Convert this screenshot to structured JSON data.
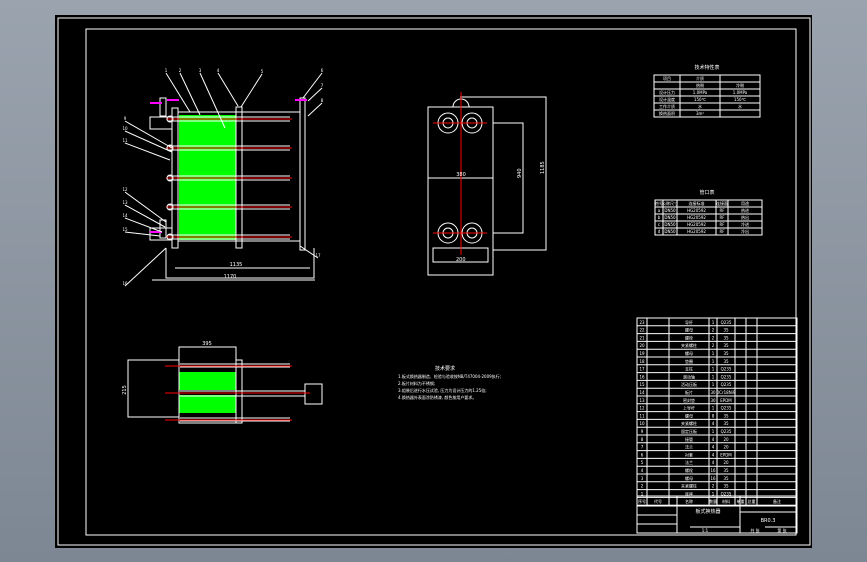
{
  "drawing": {
    "title_block": {
      "drawing_name": "板式换热器",
      "drawing_no": "BR0.3",
      "scale": "1:1",
      "sheet": "共 张",
      "sheet_of": "第 张"
    },
    "left_view": {
      "dim_inner": "1135",
      "dim_outer": "1170",
      "balloons": [
        "1",
        "2",
        "3",
        "4",
        "5",
        "6",
        "7",
        "8",
        "9",
        "10",
        "11",
        "12",
        "13",
        "14",
        "15",
        "16",
        "17"
      ]
    },
    "front_view": {
      "dim_width": "380",
      "dim_port": "200",
      "dim_height": "940",
      "dim_total_height": "1185"
    },
    "bottom_view": {
      "dim_width": "395",
      "dim_height": "215"
    },
    "notes": {
      "title": "技术要求",
      "items": [
        "1.板式换热器制造、检验与验收按NB/T47004-2009执行;",
        "2.板片材料为不锈钢;",
        "3.组装后进行水压试验, 压力为设计压力的1.25倍;",
        "4.换热器外表面涂防锈漆, 颜色按用户要求。"
      ]
    },
    "tech_table": {
      "title": "技术特性表",
      "header": [
        "项目",
        "介质",
        "热侧",
        "冷侧"
      ],
      "rows": [
        [
          "设计压力",
          "1.0MPa",
          "1.0MPa"
        ],
        [
          "设计温度",
          "150℃",
          "150℃"
        ],
        [
          "工作介质",
          "水",
          "水"
        ],
        [
          "换热面积",
          "3m²"
        ]
      ]
    },
    "nozzle_table": {
      "title": "管口表",
      "header": [
        "符号",
        "公称尺寸",
        "连接标准",
        "连接面",
        "用途"
      ],
      "rows": [
        [
          "a",
          "DN50",
          "HG20592",
          "RF",
          "热进"
        ],
        [
          "b",
          "DN50",
          "HG20592",
          "RF",
          "热出"
        ],
        [
          "c",
          "DN50",
          "HG20592",
          "RF",
          "冷进"
        ],
        [
          "d",
          "DN50",
          "HG20592",
          "RF",
          "冷出"
        ]
      ]
    },
    "parts_list": {
      "header": [
        "序号",
        "代号",
        "名称",
        "数量",
        "材料",
        "单重",
        "总重",
        "备注"
      ],
      "rows": [
        [
          "23",
          "",
          "导杆",
          "1",
          "Q235",
          "",
          ""
        ],
        [
          "22",
          "",
          "螺母",
          "2",
          "35",
          "",
          ""
        ],
        [
          "21",
          "",
          "螺栓",
          "2",
          "35",
          "",
          ""
        ],
        [
          "20",
          "",
          "夹紧螺柱",
          "2",
          "35",
          "",
          ""
        ],
        [
          "19",
          "",
          "螺母",
          "1",
          "35",
          "",
          ""
        ],
        [
          "18",
          "",
          "垫圈",
          "1",
          "35",
          "",
          ""
        ],
        [
          "17",
          "",
          "支柱",
          "1",
          "Q235",
          "",
          ""
        ],
        [
          "16",
          "",
          "滚动轴",
          "1",
          "Q235",
          "",
          ""
        ],
        [
          "15",
          "",
          "活动压板",
          "1",
          "Q235",
          "",
          ""
        ],
        [
          "14",
          "",
          "板片",
          "30",
          "0Cr18Ni9",
          "",
          ""
        ],
        [
          "13",
          "",
          "密封垫",
          "30",
          "EPDM",
          "",
          ""
        ],
        [
          "12",
          "",
          "上导杆",
          "1",
          "Q235",
          "",
          ""
        ],
        [
          "11",
          "",
          "螺母",
          "8",
          "35",
          "",
          ""
        ],
        [
          "10",
          "",
          "夹紧螺柱",
          "4",
          "35",
          "",
          ""
        ],
        [
          "9",
          "",
          "固定压板",
          "1",
          "Q235",
          "",
          ""
        ],
        [
          "8",
          "",
          "接管",
          "4",
          "20",
          "",
          ""
        ],
        [
          "7",
          "",
          "法兰",
          "4",
          "20",
          "",
          ""
        ],
        [
          "6",
          "",
          "衬套",
          "4",
          "EPDM",
          "",
          ""
        ],
        [
          "5",
          "",
          "法兰",
          "4",
          "20",
          "",
          ""
        ],
        [
          "4",
          "",
          "螺栓",
          "16",
          "35",
          "",
          ""
        ],
        [
          "3",
          "",
          "螺母",
          "16",
          "35",
          "",
          ""
        ],
        [
          "2",
          "",
          "夹紧螺柱",
          "2",
          "35",
          "",
          ""
        ],
        [
          "1",
          "",
          "底座",
          "1",
          "Q235",
          "",
          ""
        ]
      ]
    },
    "colors": {
      "line": "#ffffff",
      "center": "#ff0000",
      "plates": "#00ff00",
      "accent": "#ff00ff"
    }
  }
}
